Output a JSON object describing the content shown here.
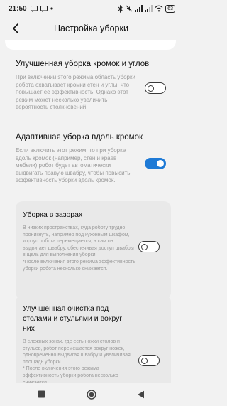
{
  "status_bar": {
    "time": "21:50",
    "battery": "63",
    "left_icons": [
      "sms-icon",
      "sms-icon",
      "dot-icon"
    ],
    "right_icons": [
      "bluetooth-icon",
      "mute-icon",
      "signal-icon",
      "signal-icon",
      "wifi-icon"
    ]
  },
  "header": {
    "title": "Настройка уборки"
  },
  "settings": [
    {
      "title": "Улучшенная уборка кромок и углов",
      "description": "При включении этого режима область уборки робота охватывает кромки стен и углы, что повышает ее эффективность. Однако этот режим может несколько увеличить вероятность столкновений",
      "enabled": false
    },
    {
      "title": "Адаптивная уборка вдоль кромок",
      "description": "Если включить этот режим, то при уборке вдоль кромок (например, стен и краев мебели) робот будет автоматически выдвигать правую швабру, чтобы повысить эффективность уборки вдоль кромок.",
      "enabled": true
    }
  ],
  "sub_settings": [
    {
      "title": "Уборка в зазорах",
      "description": "В низких пространствах, куда роботу трудно проникнуть, например под кухонным шкафом, корпус робота перемещается, а сам он выдвигает швабру, обеспечивая доступ швабры в щель для выполнения уборки\n*После включения этого режима эффективность уборки робота несколько снижается.",
      "enabled": false
    },
    {
      "title": "Улучшенная очистка под столами и стульями и вокруг них",
      "description": "В сложных зонах, где есть ножки столов и стульев, робот перемещается вокруг ножек, одновременно выдвигая швабру и увеличивая площадь уборки\n* После включения этого режима эффективность уборки робота несколько снижается",
      "enabled": false
    }
  ],
  "colors": {
    "accent": "#1e7ad6",
    "background": "#f2f2f2",
    "card": "#ffffff",
    "sub_card": "#e9e9e9"
  }
}
